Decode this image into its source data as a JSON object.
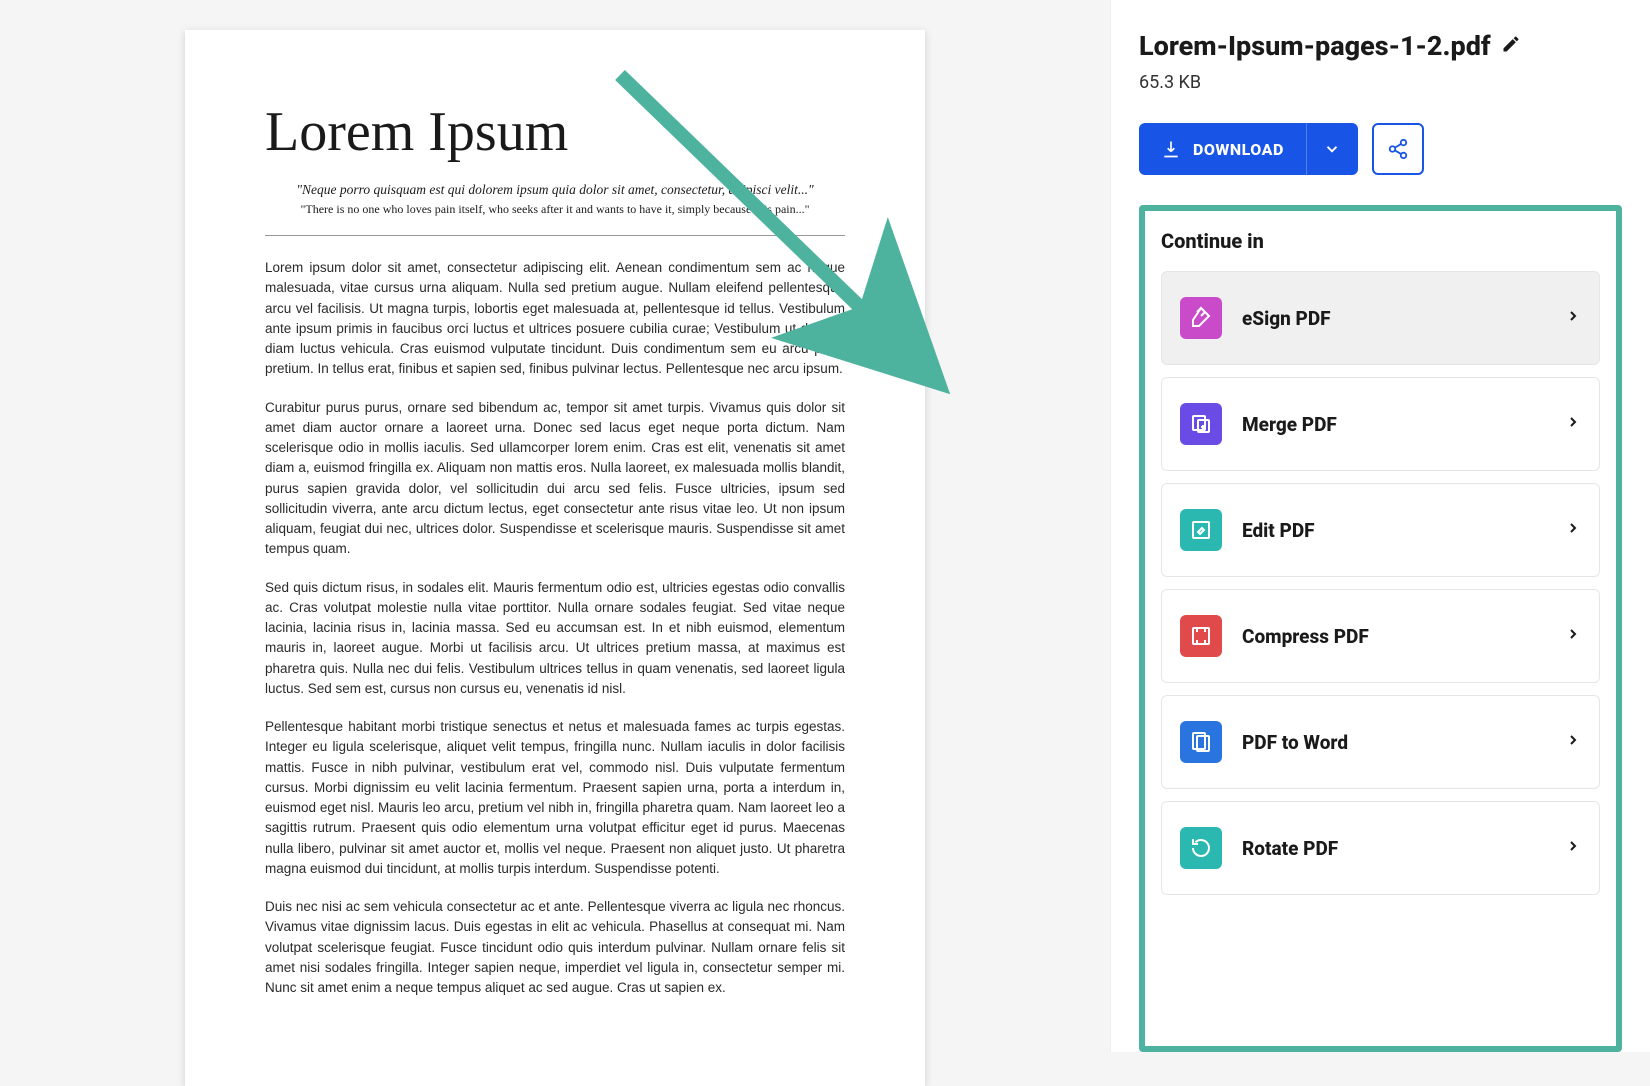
{
  "document": {
    "title": "Lorem Ipsum",
    "quote1": "\"Neque porro quisquam est qui dolorem ipsum quia dolor sit amet, consectetur, adipisci velit...\"",
    "quote2": "\"There is no one who loves pain itself, who seeks after it and wants to have it, simply because it is pain...\"",
    "paragraphs": [
      "Lorem ipsum dolor sit amet, consectetur adipiscing elit. Aenean condimentum sem ac neque malesuada, vitae cursus urna aliquam. Nulla sed pretium augue. Nullam eleifend pellentesque arcu vel facilisis. Ut magna turpis, lobortis eget malesuada at, pellentesque id tellus. Vestibulum ante ipsum primis in faucibus orci luctus et ultrices posuere cubilia curae; Vestibulum ut dui nec diam luctus vehicula. Cras euismod vulputate tincidunt. Duis condimentum sem eu arcu porta pretium. In tellus erat, finibus et sapien sed, finibus pulvinar lectus. Pellentesque nec arcu ipsum.",
      "Curabitur purus purus, ornare sed bibendum ac, tempor sit amet turpis. Vivamus quis dolor sit amet diam auctor ornare a laoreet urna. Donec sed lacus eget neque porta dictum. Nam scelerisque odio in mollis iaculis. Sed ullamcorper lorem enim. Cras est elit, venenatis sit amet diam a, euismod fringilla ex. Aliquam non mattis eros. Nulla laoreet, ex malesuada mollis blandit, purus sapien gravida dolor, vel sollicitudin dui arcu sed felis. Fusce ultricies, ipsum sed sollicitudin viverra, ante arcu dictum lectus, eget consectetur ante risus vitae leo. Ut non ipsum aliquam, feugiat dui nec, ultrices dolor. Suspendisse et scelerisque mauris. Suspendisse sit amet tempus quam.",
      "Sed quis dictum risus, in sodales elit. Mauris fermentum odio est, ultricies egestas odio convallis ac. Cras volutpat molestie nulla vitae porttitor. Nulla ornare sodales feugiat. Sed vitae neque lacinia, lacinia risus in, lacinia massa. Sed eu accumsan est. In et nibh euismod, elementum mauris in, laoreet augue. Morbi ut facilisis arcu. Ut ultrices pretium massa, at maximus est pharetra quis. Nulla nec dui felis. Vestibulum ultrices tellus in quam venenatis, sed laoreet ligula luctus. Sed sem est, cursus non cursus eu, venenatis id nisl.",
      "Pellentesque habitant morbi tristique senectus et netus et malesuada fames ac turpis egestas. Integer eu ligula scelerisque, aliquet velit tempus, fringilla nunc. Nullam iaculis in dolor facilisis mattis. Fusce in nibh pulvinar, vestibulum erat vel, commodo nisl. Duis vulputate fermentum cursus. Morbi dignissim eu velit lacinia fermentum. Praesent sapien urna, porta a interdum in, euismod eget nisl. Mauris leo arcu, pretium vel nibh in, fringilla pharetra quam. Nam laoreet leo a sagittis rutrum. Praesent quis odio elementum urna volutpat efficitur eget id purus. Maecenas nulla libero, pulvinar sit amet auctor et, mollis vel neque. Praesent non aliquet justo. Ut pharetra magna euismod dui tincidunt, at mollis turpis interdum. Suspendisse potenti.",
      "Duis nec nisi ac sem vehicula consectetur ac et ante. Pellentesque viverra ac ligula nec rhoncus. Vivamus vitae dignissim lacus. Duis egestas in elit ac vehicula. Phasellus at consequat mi. Nam volutpat scelerisque feugiat. Fusce tincidunt odio quis interdum pulvinar. Nullam ornare felis sit amet nisi sodales fringilla. Integer sapien neque, imperdiet vel ligula in, consectetur semper mi. Nunc sit amet enim a neque tempus aliquet ac sed augue. Cras ut sapien ex."
    ]
  },
  "file": {
    "name": "Lorem-Ipsum-pages-1-2.pdf",
    "size": "65.3 KB"
  },
  "actions": {
    "download": "DOWNLOAD"
  },
  "continue": {
    "title": "Continue in",
    "tools": [
      {
        "label": "eSign PDF",
        "color": "#c94bc9",
        "icon": "pen"
      },
      {
        "label": "Merge PDF",
        "color": "#6a4be6",
        "icon": "merge"
      },
      {
        "label": "Edit PDF",
        "color": "#2bb8b0",
        "icon": "edit"
      },
      {
        "label": "Compress PDF",
        "color": "#e04a4a",
        "icon": "compress"
      },
      {
        "label": "PDF to Word",
        "color": "#2a74e0",
        "icon": "word"
      },
      {
        "label": "Rotate PDF",
        "color": "#2bb8b0",
        "icon": "rotate"
      }
    ]
  }
}
